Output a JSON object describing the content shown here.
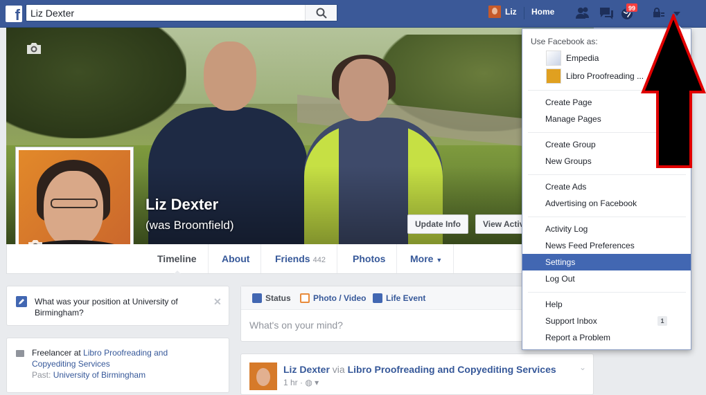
{
  "topbar": {
    "logo_letter": "f",
    "search_value": "Liz Dexter",
    "user_name": "Liz",
    "home_label": "Home",
    "notifications_count": "99"
  },
  "cover": {
    "name": "Liz Dexter",
    "alt_name": "(was Broomfield)",
    "update_info_label": "Update Info",
    "view_activity_label": "View Activity Log"
  },
  "tabs": {
    "timeline": "Timeline",
    "about": "About",
    "friends": "Friends",
    "friends_count": "442",
    "photos": "Photos",
    "more": "More"
  },
  "work_prompt": {
    "text": "What was your position at University of Birmingham?",
    "close": "✕"
  },
  "about": {
    "job_prefix": "Freelancer at ",
    "employer": "Libro Proofreading and Copyediting Services",
    "past_prefix": "Past: ",
    "past_employer": "University of Birmingham"
  },
  "composer": {
    "status": "Status",
    "photo_video": "Photo / Video",
    "life_event": "Life Event",
    "placeholder": "What's on your mind?"
  },
  "post": {
    "author": "Liz Dexter",
    "via": " via ",
    "page": "Libro Proofreading and Copyediting Services",
    "meta": "1 hr · ",
    "chevron": "⌄"
  },
  "dropdown": {
    "use_as_label": "Use Facebook as:",
    "pages": [
      "Empedia",
      "Libro Proofreading ..."
    ],
    "items": {
      "create_page": "Create Page",
      "manage_pages": "Manage Pages",
      "create_group": "Create Group",
      "new_groups": "New Groups",
      "create_ads": "Create Ads",
      "advertising": "Advertising on Facebook",
      "activity_log": "Activity Log",
      "news_feed_prefs": "News Feed Preferences",
      "settings": "Settings",
      "log_out": "Log Out",
      "help": "Help",
      "support_inbox": "Support Inbox",
      "support_inbox_count": "1",
      "report_problem": "Report a Problem"
    }
  },
  "colors": {
    "brand": "#3b5998",
    "link": "#365899",
    "highlight": "#4267b2",
    "annotation": "#e00000"
  }
}
